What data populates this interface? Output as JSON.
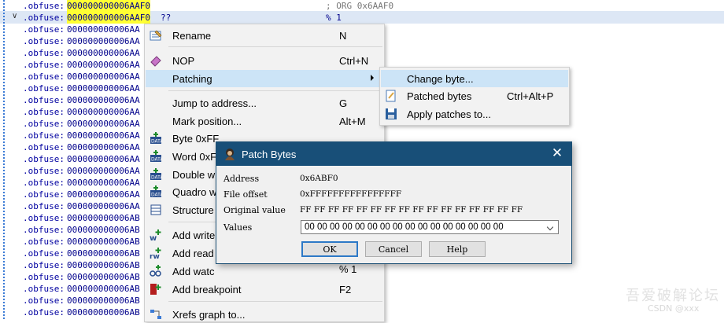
{
  "listing": {
    "prefix": ".obfuse:",
    "header_addr": "000000000006AAF0",
    "header_comment": "; ORG 0x6AAF0",
    "selected_addr": "000000000006AAF0",
    "selected_value": "??",
    "selected_comment": "% 1",
    "truncated_rows": [
      "000000000006AA",
      "000000000006AA",
      "000000000006AA",
      "000000000006AA",
      "000000000006AA",
      "000000000006AA",
      "000000000006AA",
      "000000000006AA",
      "000000000006AA",
      "000000000006AA",
      "000000000006AA",
      "000000000006AA",
      "000000000006AA",
      "000000000006AA",
      "000000000006AA",
      "000000000006AA",
      "000000000006AB",
      "000000000006AB",
      "000000000006AB",
      "000000000006AB",
      "000000000006AB",
      "000000000006AB",
      "000000000006AB",
      "000000000006AB",
      "000000000006AB"
    ]
  },
  "context_menu": {
    "items": [
      {
        "label": "Rename",
        "shortcut": "N",
        "icon": "rename-icon"
      },
      {
        "label": "NOP",
        "shortcut": "Ctrl+N",
        "icon": "eraser-icon"
      },
      {
        "label": "Patching",
        "shortcut": "",
        "icon": ""
      },
      {
        "label": "Jump to address...",
        "shortcut": "G",
        "icon": ""
      },
      {
        "label": "Mark position...",
        "shortcut": "Alt+M",
        "icon": ""
      },
      {
        "label": "Byte 0xFF",
        "shortcut": "",
        "icon": "data-byte-icon"
      },
      {
        "label": "Word 0xF",
        "shortcut": "",
        "icon": "data-word-icon"
      },
      {
        "label": "Double w",
        "shortcut": "",
        "icon": "data-double-icon"
      },
      {
        "label": "Quadro w",
        "shortcut": "",
        "icon": "data-quad-icon"
      },
      {
        "label": "Structure",
        "shortcut": "",
        "icon": "struct-icon"
      },
      {
        "label": "Add write",
        "shortcut": "",
        "icon": "write-watch-icon"
      },
      {
        "label": "Add read",
        "shortcut": "",
        "icon": "read-watch-icon"
      },
      {
        "label": "Add watc",
        "shortcut": "% 1",
        "icon": "watch-icon"
      },
      {
        "label": "Add breakpoint",
        "shortcut": "F2",
        "icon": "breakpoint-icon"
      },
      {
        "label": "Xrefs graph to...",
        "shortcut": "",
        "icon": "xrefs-icon"
      }
    ]
  },
  "patching_submenu": {
    "items": [
      {
        "label": "Change byte...",
        "shortcut": "",
        "icon": ""
      },
      {
        "label": "Patched bytes",
        "shortcut": "Ctrl+Alt+P",
        "icon": "patched-bytes-icon"
      },
      {
        "label": "Apply patches to...",
        "shortcut": "",
        "icon": "save-icon"
      }
    ]
  },
  "dialog": {
    "title": "Patch Bytes",
    "address_label": "Address",
    "address_value": "0x6ABF0",
    "file_offset_label": "File offset",
    "file_offset_value": "0xFFFFFFFFFFFFFFFF",
    "original_label": "Original value",
    "original_value": "FF FF FF FF FF FF FF FF FF FF FF FF FF FF FF FF",
    "values_label": "Values",
    "values_input": "00 00 00 00 00 00 00 00 00 00 00 00 00 00 00 00",
    "ok": "OK",
    "cancel": "Cancel",
    "help": "Help"
  },
  "watermark": {
    "text": "吾爱破解论坛",
    "sub": "CSDN @xxx"
  },
  "colors": {
    "highlight": "#ffff33",
    "title_bar": "#184f78",
    "menu_hover": "#cce4f7"
  }
}
